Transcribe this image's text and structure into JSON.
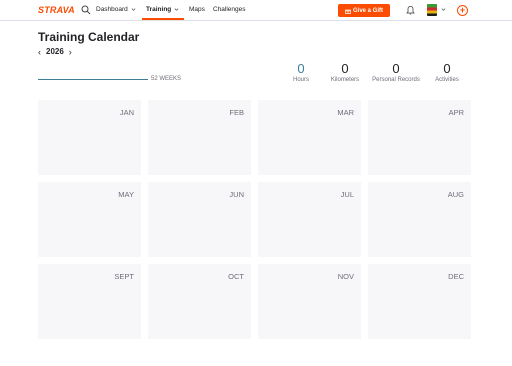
{
  "nav": {
    "logo": "STRAVA",
    "items": [
      {
        "label": "Dashboard"
      },
      {
        "label": "Training"
      },
      {
        "label": "Maps"
      },
      {
        "label": "Challenges"
      }
    ],
    "gift_label": "Give a Gift",
    "accent": "#fc4c02"
  },
  "page": {
    "title": "Training Calendar",
    "year": "2026",
    "weeks_label": "52 WEEKS"
  },
  "stats": [
    {
      "value": "0",
      "label": "Hours"
    },
    {
      "value": "0",
      "label": "Kilometers"
    },
    {
      "value": "0",
      "label": "Personal Records"
    },
    {
      "value": "0",
      "label": "Activities"
    }
  ],
  "months": [
    "JAN",
    "FEB",
    "MAR",
    "APR",
    "MAY",
    "JUN",
    "JUL",
    "AUG",
    "SEPT",
    "OCT",
    "NOV",
    "DEC"
  ]
}
